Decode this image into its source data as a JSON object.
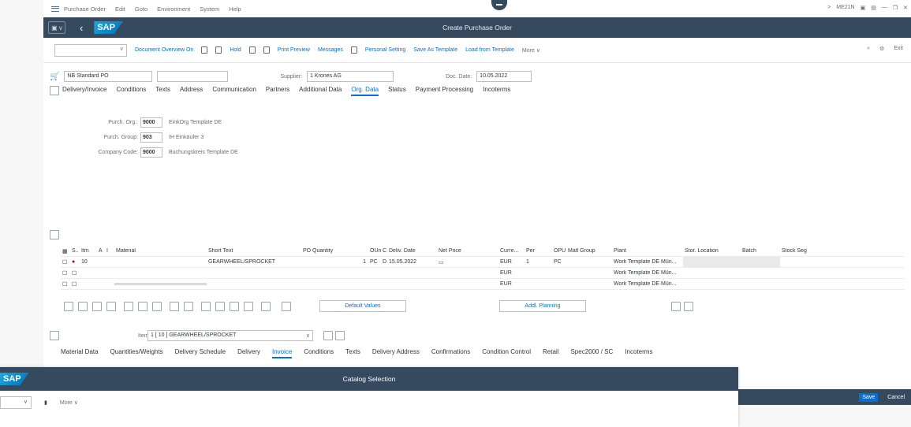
{
  "menu": {
    "items": [
      "Purchase Order",
      "Edit",
      "Goto",
      "Environment",
      "System",
      "Help"
    ],
    "tcode": "ME21N"
  },
  "shell": {
    "title": "Create Purchase Order",
    "logo": "SAP"
  },
  "toolbar": {
    "items": [
      "Document Overview On",
      "Hold",
      "Print Preview",
      "Messages",
      "Personal Setting",
      "Save As Template",
      "Load from Template",
      "More"
    ],
    "exit": "Exit"
  },
  "header": {
    "doc_type": "NB Standard PO",
    "supplier_label": "Supplier:",
    "supplier_value": "1 Krones AG",
    "doc_date_label": "Doc. Date:",
    "doc_date_value": "10.05.2022",
    "tabs": [
      "Delivery/Invoice",
      "Conditions",
      "Texts",
      "Address",
      "Communication",
      "Partners",
      "Additional Data",
      "Org. Data",
      "Status",
      "Payment Processing",
      "Incoterms"
    ],
    "active_tab": "Org. Data",
    "org": [
      {
        "label": "Purch. Org.:",
        "value": "9000",
        "desc": "EinkOrg Template DE"
      },
      {
        "label": "Purch. Group:",
        "value": "903",
        "desc": "IH Einkäufer 3"
      },
      {
        "label": "Company Code:",
        "value": "9000",
        "desc": "Buchungskreis Template DE"
      }
    ]
  },
  "items": {
    "columns": [
      "S..",
      "Itm",
      "A",
      "I",
      "Material",
      "Short Text",
      "PO Quantity",
      "OUn",
      "C",
      "Deliv. Date",
      "Net Price",
      "Curre...",
      "Per",
      "OPU",
      "Matl Group",
      "Plant",
      "Stor. Location",
      "Batch",
      "Stock Seg"
    ],
    "rows": [
      {
        "itm": "10",
        "short_text": "GEARWHEEL/SPROCKET",
        "qty": "1",
        "oun": "PC",
        "c": "D",
        "date": "15.05.2022",
        "curr": "EUR",
        "per": "1",
        "opu": "PC",
        "plant": "Work Template DE Mün..."
      },
      {
        "itm": "",
        "short_text": "",
        "qty": "",
        "oun": "",
        "c": "",
        "date": "",
        "curr": "EUR",
        "per": "",
        "opu": "",
        "plant": "Work Template DE Mün..."
      },
      {
        "itm": "",
        "short_text": "",
        "qty": "",
        "oun": "",
        "c": "",
        "date": "",
        "curr": "EUR",
        "per": "",
        "opu": "",
        "plant": "Work Template DE Mün..."
      }
    ],
    "default_values": "Default Values",
    "addl_planning": "Addl. Planning"
  },
  "detail": {
    "item_label": "Item",
    "item_value": "1 [ 10 ] GEARWHEEL/SPROCKET",
    "tabs": [
      "Material Data",
      "Quantities/Weights",
      "Delivery Schedule",
      "Delivery",
      "Invoice",
      "Conditions",
      "Texts",
      "Delivery Address",
      "Confirmations",
      "Condition Control",
      "Retail",
      "Spec2000 / SC",
      "Incoterms"
    ],
    "active_tab": "Invoice"
  },
  "catalog": {
    "title": "Catalog Selection",
    "more": "More",
    "logo": "SAP"
  },
  "footer": {
    "save": "Save",
    "cancel": "Cancel"
  },
  "colors": {
    "shell": "#354a5f",
    "accent": "#0a6ed1",
    "status_red": "#bb0000"
  }
}
